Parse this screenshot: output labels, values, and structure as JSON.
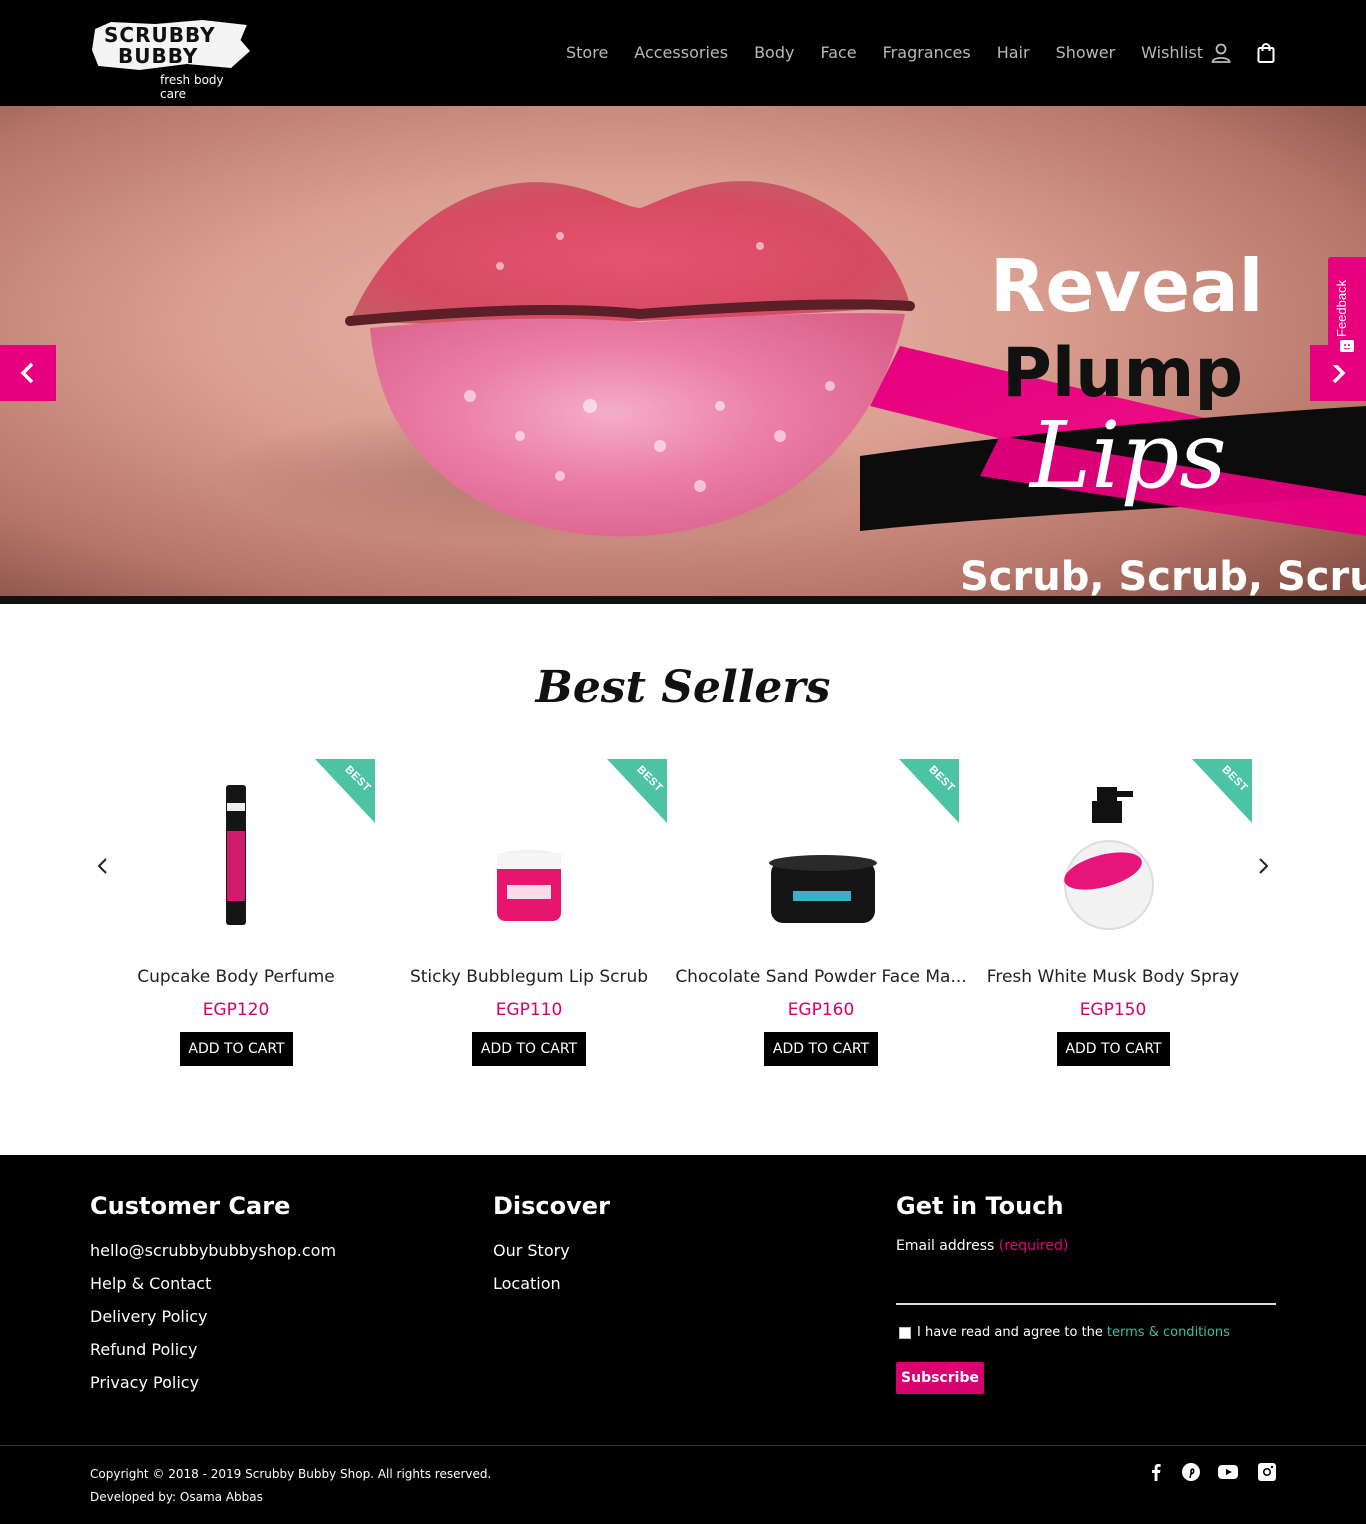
{
  "brand": {
    "logo_line1": "SCRUBBY",
    "logo_line2": "BUBBY",
    "tagline": "fresh body care",
    "accent_color": "#e6007e",
    "badge_color": "#4cc4a4"
  },
  "nav": {
    "items": [
      {
        "label": "Store"
      },
      {
        "label": "Accessories"
      },
      {
        "label": "Body"
      },
      {
        "label": "Face"
      },
      {
        "label": "Fragrances"
      },
      {
        "label": "Hair"
      },
      {
        "label": "Shower"
      },
      {
        "label": "Wishlist"
      }
    ],
    "icons": [
      "user-icon",
      "shopping-bag-icon"
    ]
  },
  "hero": {
    "line1": "Reveal",
    "line2": "Plump",
    "line3": "Lips",
    "line4": "Scrub, Scrub, Scrub",
    "feedback_label": "Feedback"
  },
  "best_sellers": {
    "title": "Best Sellers",
    "badge_label": "BEST",
    "add_to_cart_label": "ADD TO CART",
    "products": [
      {
        "name": "Cupcake Body Perfume",
        "price": "EGP120"
      },
      {
        "name": "Sticky Bubblegum Lip Scrub",
        "price": "EGP110"
      },
      {
        "name": "Chocolate Sand Powder Face Ma...",
        "price": "EGP160"
      },
      {
        "name": "Fresh White Musk Body Spray",
        "price": "EGP150"
      }
    ]
  },
  "footer": {
    "customer_care": {
      "title": "Customer Care",
      "links": [
        "hello@scrubbybubbyshop.com",
        "Help & Contact",
        "Delivery Policy",
        "Refund Policy",
        "Privacy Policy"
      ]
    },
    "discover": {
      "title": "Discover",
      "links": [
        "Our Story",
        "Location"
      ]
    },
    "get_in_touch": {
      "title": "Get in Touch",
      "email_label": "Email address",
      "email_required": "(required)",
      "agree_text": "I have read and agree to the",
      "terms_link": "terms & conditions",
      "subscribe_label": "Subscribe"
    },
    "copyright": "Copyright © 2018 - 2019 Scrubby Bubby Shop. All rights reserved.",
    "developed_by": "Developed by: Osama Abbas",
    "social_icons": [
      "facebook-icon",
      "pinterest-icon",
      "youtube-icon",
      "instagram-icon"
    ]
  }
}
